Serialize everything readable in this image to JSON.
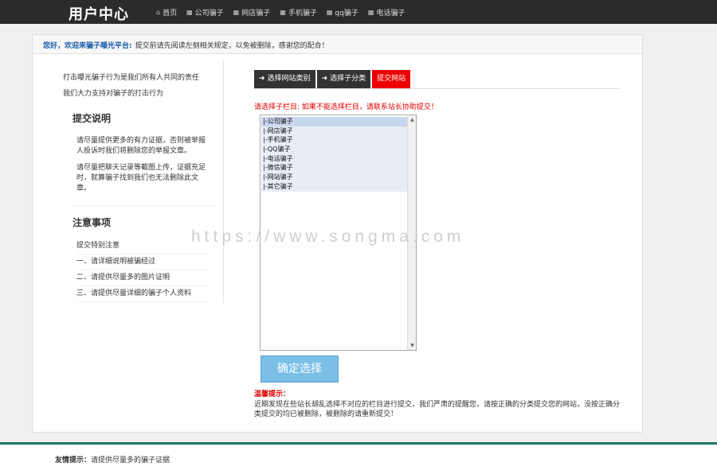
{
  "header": {
    "brand": "用户中心",
    "nav": [
      {
        "icon": "home-icon",
        "glyph": "⌂",
        "label": "首页"
      },
      {
        "icon": "grid-icon",
        "glyph": "▦",
        "label": "公司骗子"
      },
      {
        "icon": "grid-icon",
        "glyph": "▦",
        "label": "网店骗子"
      },
      {
        "icon": "grid-icon",
        "glyph": "▦",
        "label": "手机骗子"
      },
      {
        "icon": "grid-icon",
        "glyph": "▦",
        "label": "qq骗子"
      },
      {
        "icon": "grid-icon",
        "glyph": "▦",
        "label": "电话骗子"
      }
    ]
  },
  "welcome": {
    "greeting": "您好，欢迎来骗子曝光平台:",
    "notice": "提交前请先阅读左侧相关规定，以免被删除，感谢您的配合！"
  },
  "left": {
    "line1": "打击曝光骗子行为是我们所有人共同的责任",
    "line2": "我们大力支持对骗子的打击行为",
    "submit_title": "提交说明",
    "submit_p1": "请尽量提供更多的有力证据，否则被举报人投诉时我们将删除您的举报文章。",
    "submit_p2": "请尽量把聊天记录等截图上传，证据充足时，就算骗子找到我们也无法删除此文章。",
    "notes_title": "注意事项",
    "notes": [
      "提交特别注意",
      "一、请详细说明被骗经过",
      "二、请提供尽量多的图片证明",
      "三、请提供尽量详细的骗子个人资料"
    ]
  },
  "tabs": [
    {
      "label": "选择网站类别",
      "arrow": "➜"
    },
    {
      "label": "选择子分类",
      "arrow": "➜"
    },
    {
      "label": "提交网站",
      "arrow": ""
    }
  ],
  "hint": "请选择子栏目: 如果不能选择栏目，请联系站长协助提交！",
  "listbox": {
    "options": [
      "|-公司骗子",
      "|-网店骗子",
      "|-手机骗子",
      "|-QQ骗子",
      "|-电话骗子",
      "|-微信骗子",
      "|-网站骗子",
      "|-其它骗子"
    ],
    "selected_index": 0
  },
  "confirm_label": "确定选择",
  "warning": {
    "title": "温馨提示：",
    "text": "近期发现在些站长胡乱选择不对应的栏目进行提交，我们严肃的提醒您，请按正确的分类提交您的网站，没按正确分类提交的均已被删除，被删除的请重新提交！"
  },
  "watermark": "https://www.songma.com",
  "footer": {
    "label": "友情提示：",
    "text": "请提供尽量多的骗子证据"
  },
  "colors": {
    "active_tab": "#ee0000",
    "header_bg": "#2b2b2b",
    "footer_bar": "#1a7a6b",
    "button": "#7bbfe6"
  }
}
